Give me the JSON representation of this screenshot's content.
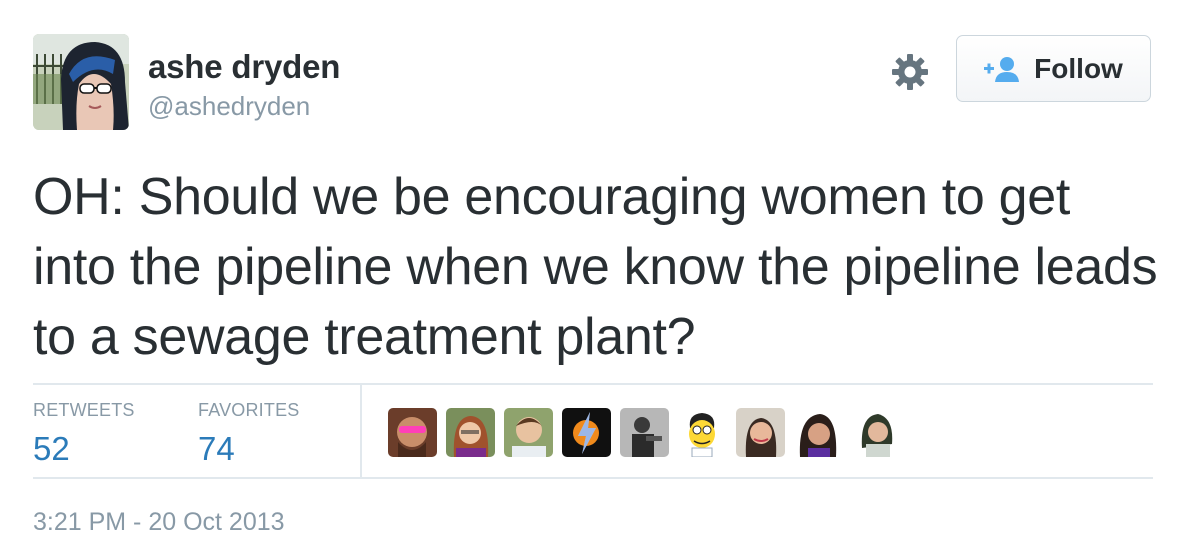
{
  "author": {
    "name": "ashe dryden",
    "handle": "@ashedryden"
  },
  "follow_label": "Follow",
  "tweet_text": "OH: Should we be encouraging women to get into the pipeline when we know the pipeline leads to a sewage treatment plant?",
  "stats": {
    "retweets_label": "RETWEETS",
    "retweets_count": "52",
    "favorites_label": "FAVORITES",
    "favorites_count": "74"
  },
  "timestamp": "3:21 PM - 20 Oct 2013",
  "colors": {
    "link_blue": "#2b7bb9",
    "text": "#292f33",
    "muted": "#8899a6",
    "follow_icon": "#55acee"
  },
  "icons": [
    "gear-icon",
    "add-user-icon"
  ]
}
